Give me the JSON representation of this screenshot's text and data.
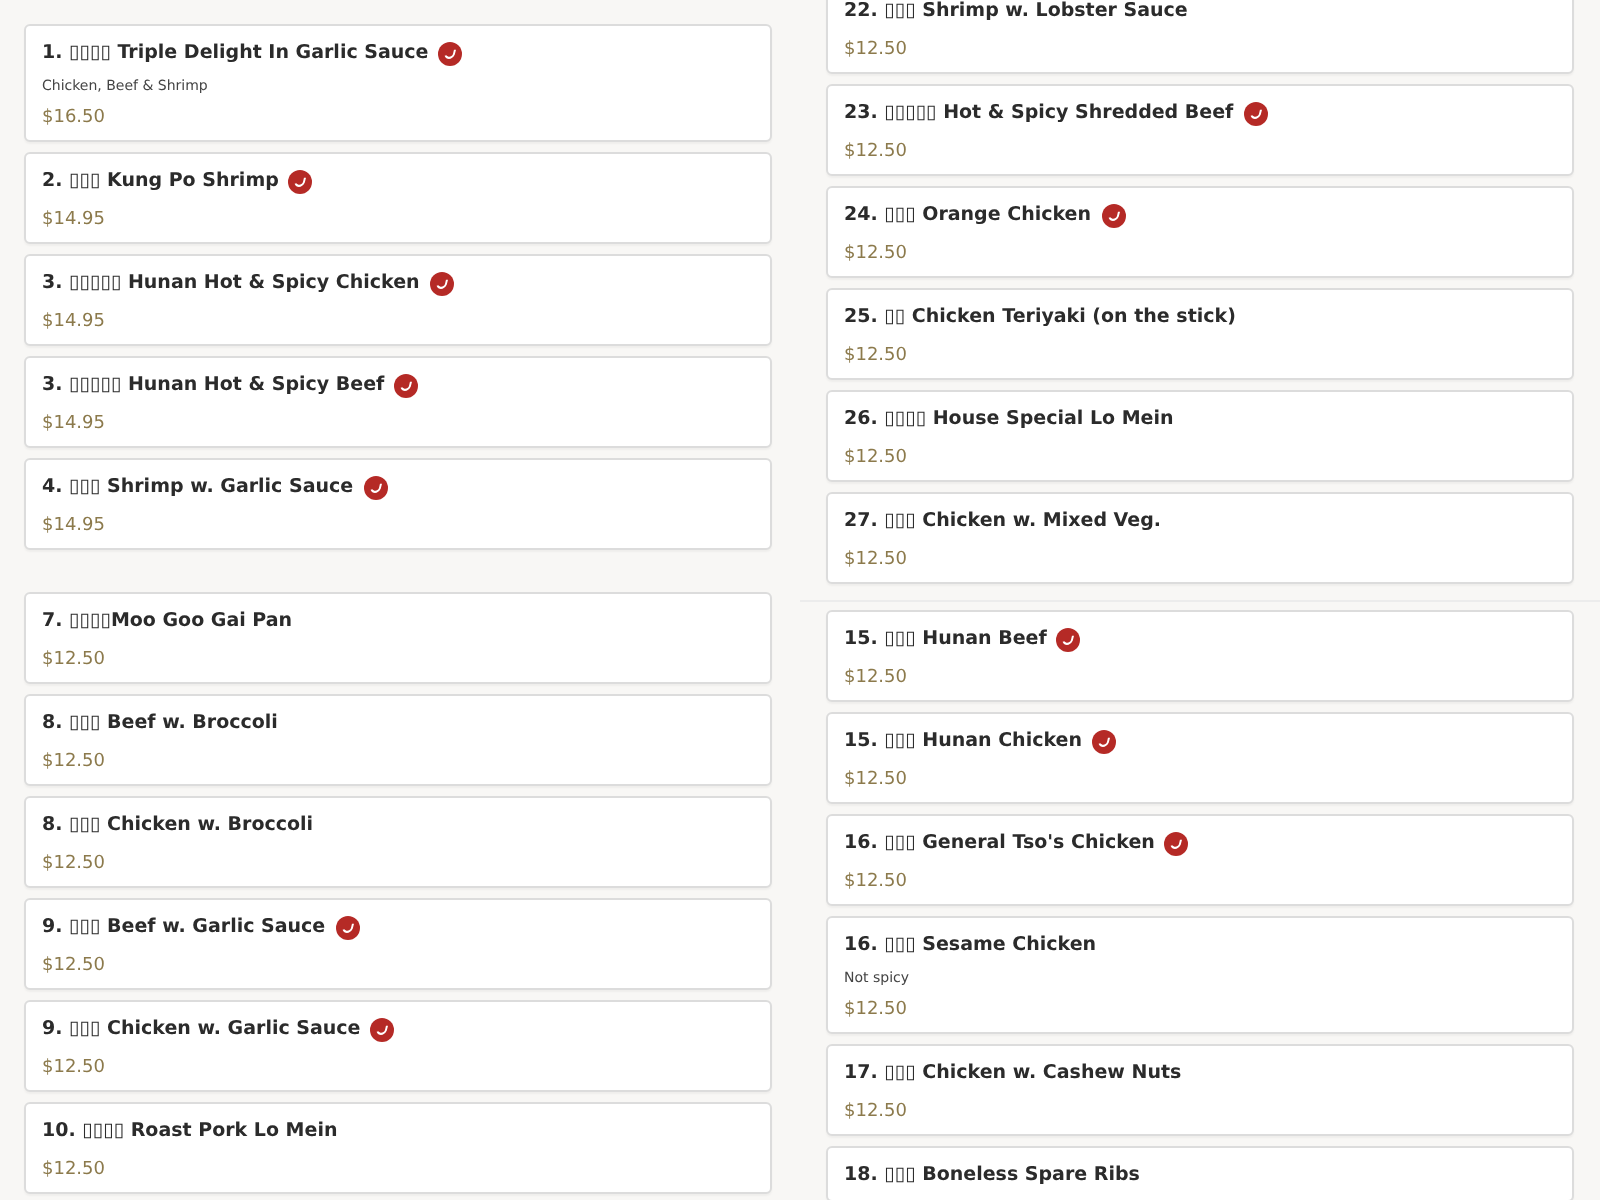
{
  "panels": [
    {
      "items": [
        {
          "title": "1. ▯▯▯▯ Triple Delight In Garlic Sauce",
          "spicy": true,
          "description": "Chicken, Beef & Shrimp",
          "price": "$16.50"
        },
        {
          "title": "2. ▯▯▯ Kung Po Shrimp",
          "spicy": true,
          "price": "$14.95"
        },
        {
          "title": "3. ▯▯▯▯▯ Hunan Hot & Spicy Chicken",
          "spicy": true,
          "price": "$14.95"
        },
        {
          "title": "3. ▯▯▯▯▯ Hunan Hot & Spicy Beef",
          "spicy": true,
          "price": "$14.95"
        },
        {
          "title": "4. ▯▯▯ Shrimp w. Garlic Sauce",
          "spicy": true,
          "price": "$14.95"
        }
      ]
    },
    {
      "items": [
        {
          "title": "22. ▯▯▯ Shrimp w. Lobster Sauce",
          "spicy": false,
          "price": "$12.50"
        },
        {
          "title": "23. ▯▯▯▯▯ Hot & Spicy Shredded Beef",
          "spicy": true,
          "price": "$12.50"
        },
        {
          "title": "24. ▯▯▯ Orange Chicken",
          "spicy": true,
          "price": "$12.50"
        },
        {
          "title": "25. ▯▯ Chicken Teriyaki (on the stick)",
          "spicy": false,
          "price": "$12.50"
        },
        {
          "title": "26. ▯▯▯▯ House Special Lo Mein",
          "spicy": false,
          "price": "$12.50"
        },
        {
          "title": "27. ▯▯▯ Chicken w. Mixed Veg.",
          "spicy": false,
          "price": "$12.50"
        }
      ]
    },
    {
      "items": [
        {
          "title": "7. ▯▯▯▯Moo Goo Gai Pan",
          "spicy": false,
          "price": "$12.50"
        },
        {
          "title": "8. ▯▯▯ Beef w. Broccoli",
          "spicy": false,
          "price": "$12.50"
        },
        {
          "title": "8. ▯▯▯ Chicken w. Broccoli",
          "spicy": false,
          "price": "$12.50"
        },
        {
          "title": "9. ▯▯▯ Beef w. Garlic Sauce",
          "spicy": true,
          "price": "$12.50"
        },
        {
          "title": "9. ▯▯▯ Chicken w. Garlic Sauce",
          "spicy": true,
          "price": "$12.50"
        },
        {
          "title": "10. ▯▯▯▯ Roast Pork Lo Mein",
          "spicy": false,
          "price": "$12.50"
        }
      ]
    },
    {
      "items": [
        {
          "title": "15. ▯▯▯ Hunan Beef",
          "spicy": true,
          "price": "$12.50"
        },
        {
          "title": "15. ▯▯▯ Hunan Chicken",
          "spicy": true,
          "price": "$12.50"
        },
        {
          "title": "16. ▯▯▯ General Tso's Chicken",
          "spicy": true,
          "price": "$12.50"
        },
        {
          "title": "16. ▯▯▯ Sesame Chicken",
          "spicy": false,
          "description": "Not spicy",
          "price": "$12.50"
        },
        {
          "title": "17. ▯▯▯ Chicken w. Cashew Nuts",
          "spicy": false,
          "price": "$12.50"
        },
        {
          "title": "18. ▯▯▯ Boneless Spare Ribs",
          "spicy": false
        }
      ]
    }
  ]
}
